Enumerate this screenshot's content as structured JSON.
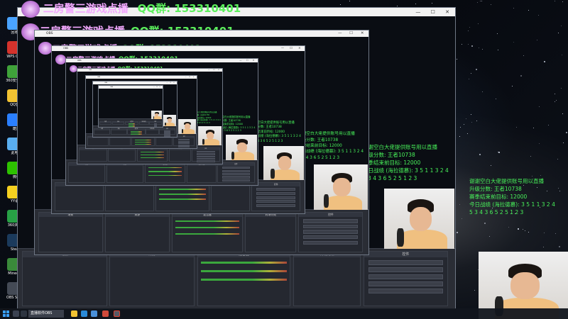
{
  "banner": {
    "streamer": "二房警三游戏点播",
    "qq": "QQ群: 153310401"
  },
  "window": {
    "title": "OBS",
    "controls": "— ☐ ✕"
  },
  "docks": {
    "scenes": "场景",
    "sources": "来源",
    "mixer": "混音器",
    "transitions": "转场特效",
    "controls": "控件"
  },
  "overlay": {
    "thanks": "谢谢空白大佬提供账号用以直播",
    "rank_score": "升级分数: 王者10738",
    "season_goal": "赛季结束前目标: 12000",
    "today_stats": "今日战绩 (海拉德慕): 3 5 1 1 3 2 4",
    "digits": "5 3 4 3 6 5 2 5 1 2 3"
  },
  "desktop_icons": [
    {
      "label": "回收站",
      "icon": "recycle-icon",
      "color": "#4aa3ff"
    },
    {
      "label": "WPS Office",
      "icon": "wps-icon",
      "color": "#d4322c"
    },
    {
      "label": "360安全卫士",
      "icon": "shield-icon",
      "color": "#3fa23a"
    },
    {
      "label": "QQ音乐",
      "icon": "music-icon",
      "color": "#f1c232"
    },
    {
      "label": "酷狗",
      "icon": "kugou-icon",
      "color": "#2a7fff"
    },
    {
      "label": "此电脑",
      "icon": "computer-icon",
      "color": "#5aaef0"
    },
    {
      "label": "微信",
      "icon": "wechat-icon",
      "color": "#2dc100"
    },
    {
      "label": "YY语音",
      "icon": "yy-icon",
      "color": "#f5d020"
    },
    {
      "label": "360浏览器",
      "icon": "browser-icon",
      "color": "#27a045"
    },
    {
      "label": "Steam",
      "icon": "steam-icon",
      "color": "#1b3a5c"
    },
    {
      "label": "Minecraft",
      "icon": "game-icon",
      "color": "#3a8a3a"
    },
    {
      "label": "OBS Studio",
      "icon": "obs-icon",
      "color": "#444a55"
    }
  ],
  "taskbar": {
    "obs_label": "直播软件OBS"
  }
}
